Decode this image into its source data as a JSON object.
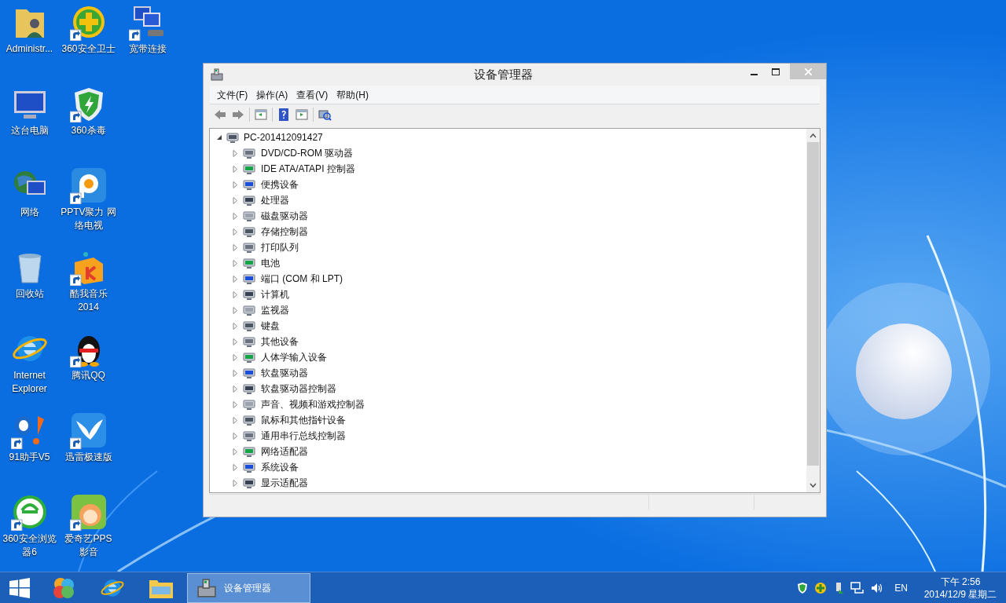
{
  "desktop": {
    "columns": [
      [
        {
          "label": "Administr..."
        },
        {
          "label": "这台电脑"
        },
        {
          "label": "网络"
        },
        {
          "label": "回收站"
        },
        {
          "label": "Internet Explorer"
        },
        {
          "label": "91助手V5",
          "shortcut": true
        },
        {
          "label": "360安全浏览器6",
          "shortcut": true
        }
      ],
      [
        {
          "label": "360安全卫士",
          "shortcut": true
        },
        {
          "label": "360杀毒",
          "shortcut": true
        },
        {
          "label": "PPTV聚力 网络电视",
          "shortcut": true
        },
        {
          "label": "酷我音乐 2014",
          "shortcut": true
        },
        {
          "label": "腾讯QQ",
          "shortcut": true
        },
        {
          "label": "迅雷极速版",
          "shortcut": true
        },
        {
          "label": "爱奇艺PPS 影音",
          "shortcut": true
        }
      ],
      [
        {
          "label": "宽带连接",
          "shortcut": true
        }
      ]
    ]
  },
  "window": {
    "title": "设备管理器",
    "menu": [
      "文件(F)",
      "操作(A)",
      "查看(V)",
      "帮助(H)"
    ],
    "tree": {
      "label": "PC-201412091427",
      "expanded": true,
      "children": [
        {
          "label": "DVD/CD-ROM 驱动器",
          "expanded": false
        },
        {
          "label": "IDE ATA/ATAPI 控制器",
          "expanded": false
        },
        {
          "label": "便携设备",
          "expanded": false
        },
        {
          "label": "处理器",
          "expanded": false
        },
        {
          "label": "磁盘驱动器",
          "expanded": false
        },
        {
          "label": "存储控制器",
          "expanded": false
        },
        {
          "label": "打印队列",
          "expanded": false
        },
        {
          "label": "电池",
          "expanded": false
        },
        {
          "label": "端口 (COM 和 LPT)",
          "expanded": false
        },
        {
          "label": "计算机",
          "expanded": false
        },
        {
          "label": "监视器",
          "expanded": false
        },
        {
          "label": "键盘",
          "expanded": false
        },
        {
          "label": "其他设备",
          "expanded": false
        },
        {
          "label": "人体学输入设备",
          "expanded": false
        },
        {
          "label": "软盘驱动器",
          "expanded": false
        },
        {
          "label": "软盘驱动器控制器",
          "expanded": false
        },
        {
          "label": "声音、视频和游戏控制器",
          "expanded": false
        },
        {
          "label": "鼠标和其他指针设备",
          "expanded": false
        },
        {
          "label": "通用串行总线控制器",
          "expanded": false
        },
        {
          "label": "网络适配器",
          "expanded": false
        },
        {
          "label": "系统设备",
          "expanded": false
        },
        {
          "label": "显示适配器",
          "expanded": false
        }
      ]
    }
  },
  "taskbar": {
    "tasks": [
      {
        "label": "设备管理器",
        "selected": true
      }
    ],
    "language": "EN",
    "time": "下午 2:56",
    "date": "2014/12/9 星期二"
  }
}
